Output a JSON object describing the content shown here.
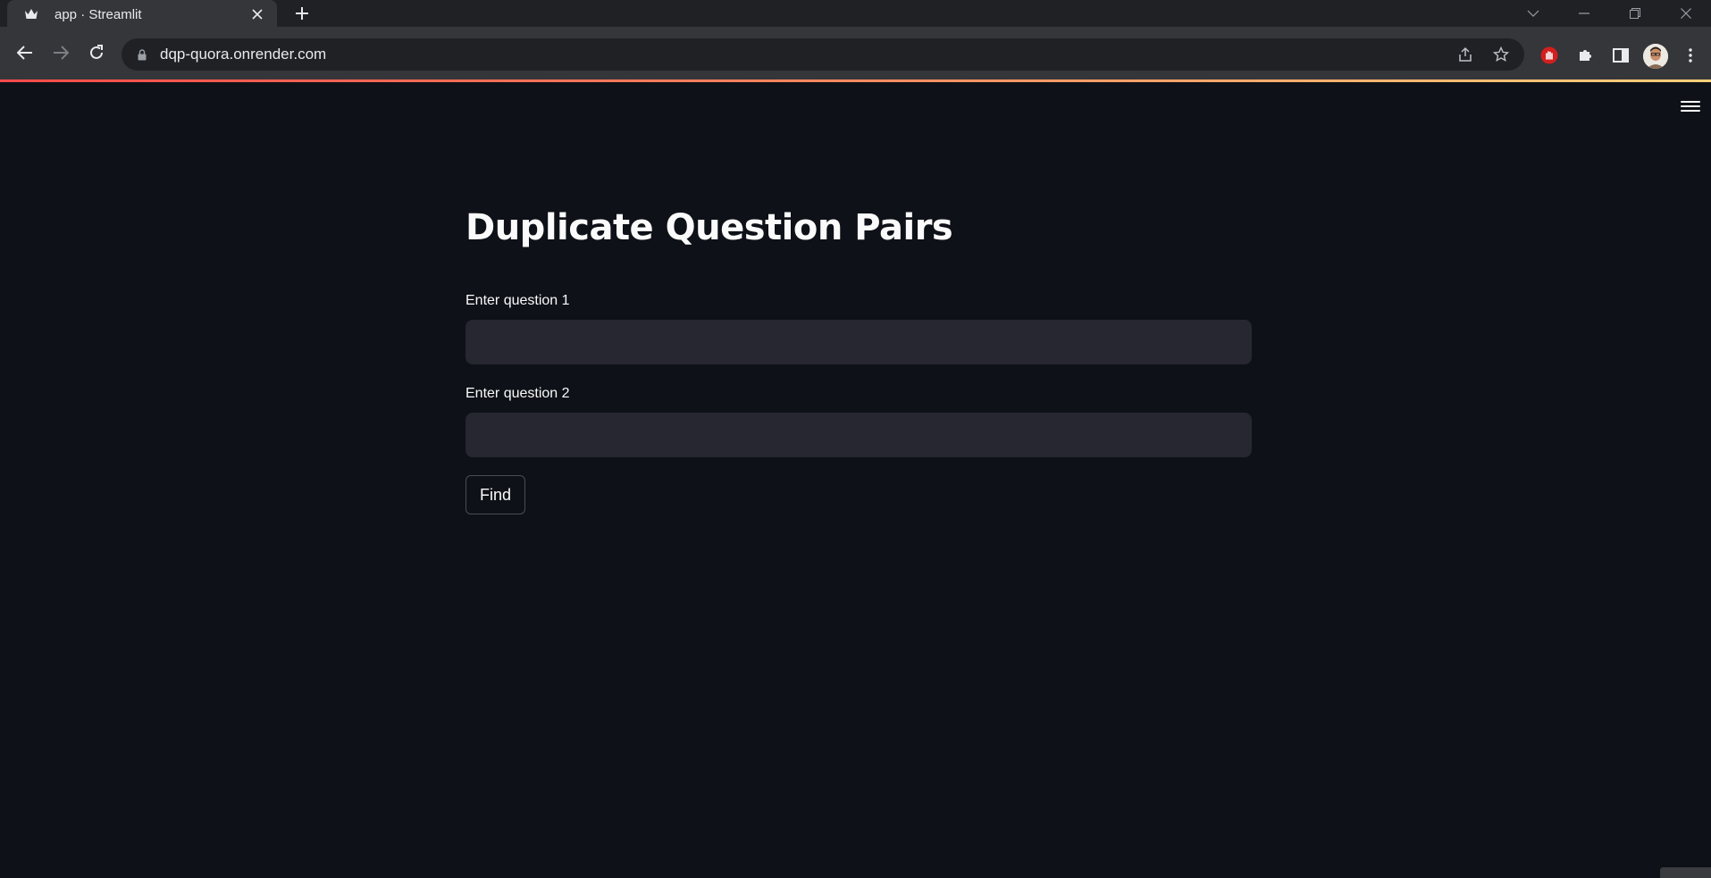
{
  "browser": {
    "tab_title": "app · Streamlit",
    "url": "dqp-quora.onrender.com",
    "icons": {
      "favicon": "streamlit-crown-icon",
      "close": "close-icon",
      "new_tab": "plus-icon",
      "back": "arrow-left-icon",
      "forward": "arrow-right-icon",
      "reload": "reload-icon",
      "lock": "lock-icon",
      "share": "share-icon",
      "bookmark": "star-icon",
      "ext_block": "hand-stop-icon",
      "extensions": "puzzle-icon",
      "side_panel": "side-panel-icon",
      "menu": "kebab-menu-icon"
    },
    "loadbar_colors": [
      "#ff4b4b",
      "#ffd07a"
    ]
  },
  "page": {
    "title": "Duplicate Question Pairs",
    "q1_label": "Enter question 1",
    "q1_value": "",
    "q2_label": "Enter question 2",
    "q2_value": "",
    "find_label": "Find",
    "menu_icon": "hamburger-menu-icon"
  },
  "colors": {
    "background": "#0e1117",
    "input_bg": "#262730",
    "text": "#fafafa",
    "chrome_bg": "#35363a"
  }
}
